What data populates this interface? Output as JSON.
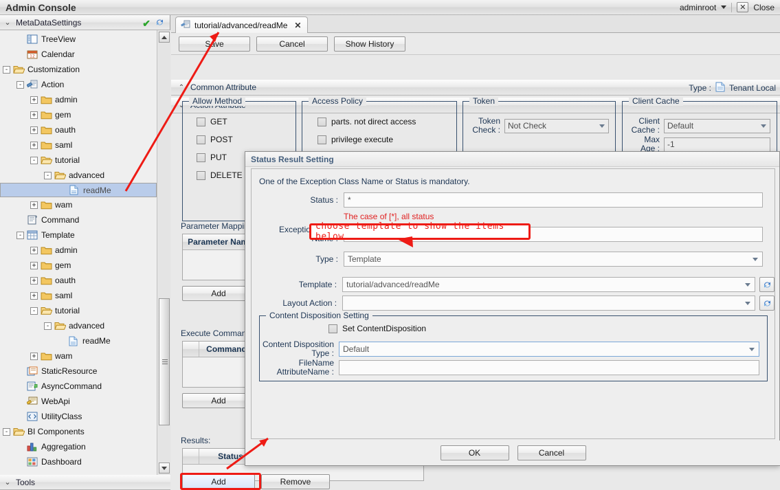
{
  "app": {
    "title": "Admin Console",
    "user": "adminroot",
    "close_label": "Close",
    "close_icon": "close-icon"
  },
  "sidebar": {
    "header": {
      "label": "MetaDataSettings",
      "chevron": "⌄",
      "check_icon": "✔",
      "refresh_icon": "refresh-icon"
    },
    "footer": {
      "label": "Tools",
      "chevron": "⌄"
    },
    "tree": [
      {
        "label": "TreeView",
        "depth": 2,
        "expander": "",
        "icon": "treeview-icon",
        "selected": false
      },
      {
        "label": "Calendar",
        "depth": 2,
        "expander": "",
        "icon": "calendar-icon",
        "selected": false
      },
      {
        "label": "Customization",
        "depth": 1,
        "expander": "-",
        "icon": "folder-open-icon",
        "selected": false
      },
      {
        "label": "Action",
        "depth": 2,
        "expander": "-",
        "icon": "action-icon",
        "selected": false
      },
      {
        "label": "admin",
        "depth": 3,
        "expander": "+",
        "icon": "folder-icon",
        "selected": false
      },
      {
        "label": "gem",
        "depth": 3,
        "expander": "+",
        "icon": "folder-icon",
        "selected": false
      },
      {
        "label": "oauth",
        "depth": 3,
        "expander": "+",
        "icon": "folder-icon",
        "selected": false
      },
      {
        "label": "saml",
        "depth": 3,
        "expander": "+",
        "icon": "folder-icon",
        "selected": false
      },
      {
        "label": "tutorial",
        "depth": 3,
        "expander": "-",
        "icon": "folder-open-icon",
        "selected": false
      },
      {
        "label": "advanced",
        "depth": 4,
        "expander": "-",
        "icon": "folder-open-icon",
        "selected": false
      },
      {
        "label": "readMe",
        "depth": 5,
        "expander": "",
        "icon": "file-icon",
        "selected": true
      },
      {
        "label": "wam",
        "depth": 3,
        "expander": "+",
        "icon": "folder-icon",
        "selected": false
      },
      {
        "label": "Command",
        "depth": 2,
        "expander": "",
        "icon": "command-icon",
        "selected": false
      },
      {
        "label": "Template",
        "depth": 2,
        "expander": "-",
        "icon": "template-icon",
        "selected": false
      },
      {
        "label": "admin",
        "depth": 3,
        "expander": "+",
        "icon": "folder-icon",
        "selected": false
      },
      {
        "label": "gem",
        "depth": 3,
        "expander": "+",
        "icon": "folder-icon",
        "selected": false
      },
      {
        "label": "oauth",
        "depth": 3,
        "expander": "+",
        "icon": "folder-icon",
        "selected": false
      },
      {
        "label": "saml",
        "depth": 3,
        "expander": "+",
        "icon": "folder-icon",
        "selected": false
      },
      {
        "label": "tutorial",
        "depth": 3,
        "expander": "-",
        "icon": "folder-open-icon",
        "selected": false
      },
      {
        "label": "advanced",
        "depth": 4,
        "expander": "-",
        "icon": "folder-open-icon",
        "selected": false
      },
      {
        "label": "readMe",
        "depth": 5,
        "expander": "",
        "icon": "file-icon",
        "selected": false
      },
      {
        "label": "wam",
        "depth": 3,
        "expander": "+",
        "icon": "folder-icon",
        "selected": false
      },
      {
        "label": "StaticResource",
        "depth": 2,
        "expander": "",
        "icon": "staticresource-icon",
        "selected": false
      },
      {
        "label": "AsyncCommand",
        "depth": 2,
        "expander": "",
        "icon": "asynccommand-icon",
        "selected": false
      },
      {
        "label": "WebApi",
        "depth": 2,
        "expander": "",
        "icon": "webapi-icon",
        "selected": false
      },
      {
        "label": "UtilityClass",
        "depth": 2,
        "expander": "",
        "icon": "utilityclass-icon",
        "selected": false
      },
      {
        "label": "BI Components",
        "depth": 1,
        "expander": "-",
        "icon": "folder-open-icon",
        "selected": false
      },
      {
        "label": "Aggregation",
        "depth": 2,
        "expander": "",
        "icon": "aggregation-icon",
        "selected": false
      },
      {
        "label": "Dashboard",
        "depth": 2,
        "expander": "",
        "icon": "dashboard-icon",
        "selected": false
      }
    ]
  },
  "main": {
    "tab": {
      "label": "tutorial/advanced/readMe",
      "icon": "action-icon",
      "close": "✕"
    },
    "toolbar": {
      "save": "Save",
      "cancel": "Cancel",
      "show_history": "Show History"
    },
    "sections": {
      "common": {
        "label": "Common Attribute",
        "chevron": "⌃",
        "type_label": "Type :",
        "type_value": "Tenant Local",
        "type_icon": "file-icon"
      },
      "action": {
        "label": "Action Attribute",
        "chevron": "⌄"
      }
    },
    "allow_method": {
      "legend": "Allow Method",
      "items": [
        {
          "label": "GET",
          "checked": false
        },
        {
          "label": "POST",
          "checked": false
        },
        {
          "label": "PUT",
          "checked": false
        },
        {
          "label": "DELETE",
          "checked": false
        }
      ]
    },
    "access_policy": {
      "legend": "Access Policy",
      "items": [
        {
          "label": "parts. not direct access",
          "checked": false
        },
        {
          "label": "privilege execute",
          "checked": false
        }
      ]
    },
    "token": {
      "legend": "Token",
      "check_label": "Token\nCheck :",
      "check_value": "Not Check"
    },
    "client_cache": {
      "legend": "Client Cache",
      "cache_label": "Client\nCache :",
      "cache_value": "Default",
      "maxage_label": "Max\nAge :",
      "maxage_value": "-1"
    },
    "parameter_mapping": {
      "label": "Parameter Mapping:",
      "column": "Parameter Name",
      "add": "Add"
    },
    "execute_command": {
      "label": "Execute Command:",
      "column": "Command N",
      "add": "Add"
    },
    "results": {
      "label": "Results:",
      "column": "Status",
      "add": "Add",
      "remove": "Remove"
    }
  },
  "dialog": {
    "title": "Status Result Setting",
    "notice": "One of the Exception Class Name or Status is mandatory.",
    "status_label": "Status :",
    "status_value": "*",
    "status_hint": "The case of [*], all status",
    "exception_label": "Exception Class\nName :",
    "exception_value": "",
    "type_label": "Type :",
    "type_value": "Template",
    "template_label": "Template :",
    "template_value": "tutorial/advanced/readMe",
    "layout_action_label": "Layout Action :",
    "layout_action_value": "",
    "refresh_icon": "refresh-icon",
    "content_disposition": {
      "legend": "Content Disposition Setting",
      "checkbox_label": "Set ContentDisposition",
      "checkbox_checked": false,
      "type_label": "Content Disposition\nType :",
      "type_value": "Default",
      "filename_label": "FileName\nAttributeName :",
      "filename_value": ""
    },
    "ok": "OK",
    "cancel": "Cancel"
  },
  "annotations": {
    "callout_text": "choose template to show the items below",
    "color": "#ee1b15"
  }
}
